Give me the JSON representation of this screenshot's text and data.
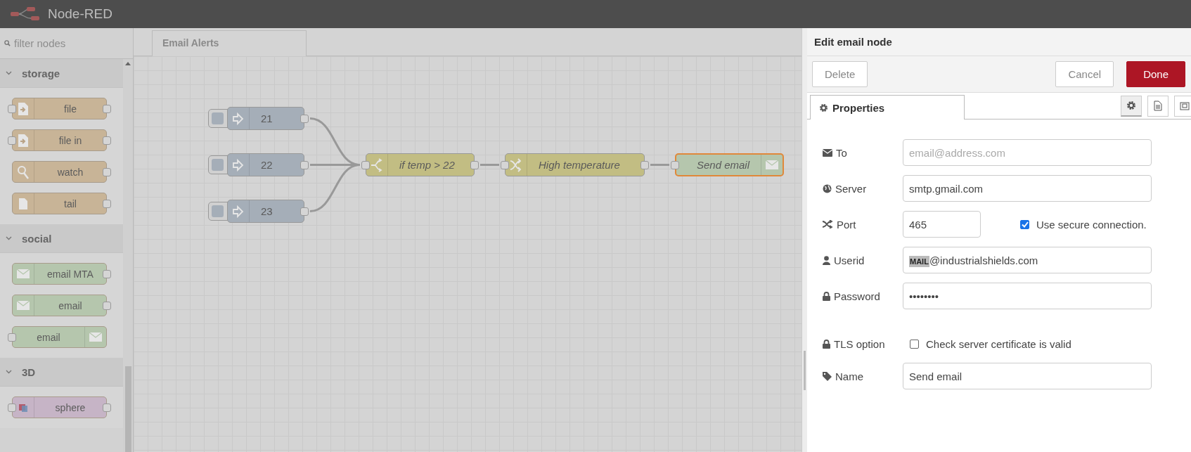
{
  "header": {
    "title": "Node-RED"
  },
  "palette": {
    "filter_placeholder": "filter nodes",
    "categories": [
      {
        "name": "storage",
        "expanded": true,
        "nodes": [
          {
            "label": "file",
            "kind": "file-out",
            "color": "#c8b497"
          },
          {
            "label": "file in",
            "kind": "file-in",
            "color": "#c8b497"
          },
          {
            "label": "watch",
            "kind": "watch",
            "color": "#c8b497"
          },
          {
            "label": "tail",
            "kind": "tail",
            "color": "#c8b497"
          }
        ]
      },
      {
        "name": "social",
        "expanded": true,
        "nodes": [
          {
            "label": "email MTA",
            "kind": "email-in",
            "color": "#b5c6ad"
          },
          {
            "label": "email",
            "kind": "email-in",
            "color": "#b5c6ad"
          },
          {
            "label": "email",
            "kind": "email-out",
            "color": "#b5c6ad"
          }
        ]
      },
      {
        "name": "3D",
        "expanded": true,
        "nodes": [
          {
            "label": "sphere",
            "kind": "sphere",
            "color": "#c6b4c6"
          }
        ]
      }
    ]
  },
  "workspace": {
    "tabs": [
      {
        "label": "Email Alerts",
        "selected": true
      }
    ],
    "nodes": [
      {
        "label": "21",
        "kind": "inject",
        "color": "#a5aeb8",
        "italic": false,
        "selected": false
      },
      {
        "label": "22",
        "kind": "inject",
        "color": "#a5aeb8",
        "italic": false,
        "selected": false
      },
      {
        "label": "23",
        "kind": "inject",
        "color": "#a5aeb8",
        "italic": false,
        "selected": false
      },
      {
        "label": "if temp > 22",
        "kind": "switch",
        "color": "#c2bd83",
        "italic": true,
        "selected": false
      },
      {
        "label": "High temperature",
        "kind": "change",
        "color": "#c2bd83",
        "italic": true,
        "selected": false
      },
      {
        "label": "Send email",
        "kind": "email-out",
        "color": "#b5c6ad",
        "italic": true,
        "selected": true
      }
    ]
  },
  "editor": {
    "title": "Edit email node",
    "buttons": [
      {
        "label": "Delete",
        "kind": "plain"
      },
      {
        "label": "Cancel",
        "kind": "plain"
      },
      {
        "label": "Done",
        "kind": "primary"
      }
    ],
    "tabs": [
      {
        "label": "Properties",
        "selected": true
      }
    ],
    "icon_tabs": [
      {
        "kind": "gear",
        "selected": true
      },
      {
        "kind": "document",
        "selected": false
      },
      {
        "kind": "frame",
        "selected": false
      }
    ],
    "fields": [
      {
        "kind": "input",
        "label": "To",
        "placeholder": "email@address.com"
      },
      {
        "kind": "input",
        "label": "Server",
        "value": "smtp.gmail.com"
      },
      {
        "kind": "port",
        "label": "Port",
        "value": "465",
        "checkbox": {
          "label": "Use secure connection.",
          "checked": true
        }
      },
      {
        "kind": "rich",
        "label": "Userid",
        "value": "**MAIL**@industrialshields.com"
      },
      {
        "kind": "input",
        "label": "Password",
        "value": "••••••••"
      },
      {
        "kind": "checkbox",
        "label": "TLS option",
        "checkbox": {
          "label": "Check server certificate is valid",
          "checked": false
        }
      },
      {
        "kind": "input",
        "label": "Name",
        "value": "Send email"
      }
    ]
  }
}
